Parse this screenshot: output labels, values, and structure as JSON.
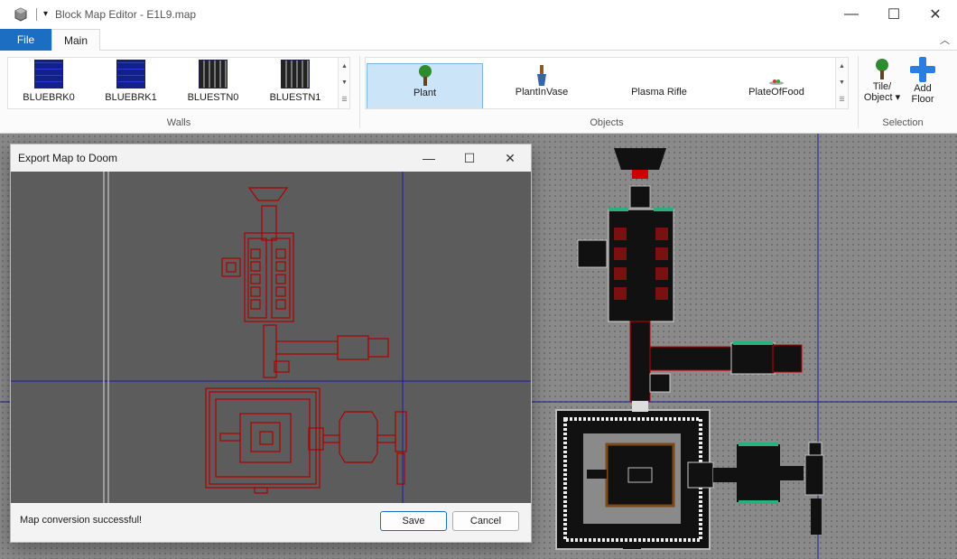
{
  "window": {
    "title": "Block Map Editor - E1L9.map",
    "qat_glyph": "▾",
    "minimize": "—",
    "maximize": "☐",
    "close": "✕"
  },
  "tabs": {
    "file": "File",
    "main": "Main",
    "collapse_glyph": "︿"
  },
  "ribbon": {
    "walls": {
      "label": "Walls",
      "items": [
        {
          "name": "BLUEBRK0",
          "color": "#1a2aa8"
        },
        {
          "name": "BLUEBRK1",
          "color": "#1a2aa8"
        },
        {
          "name": "BLUESTN0",
          "color": "#3a3a3a"
        },
        {
          "name": "BLUESTN1",
          "color": "#3a3a3a"
        }
      ]
    },
    "objects": {
      "label": "Objects",
      "items": [
        {
          "name": "Plant",
          "selected": true
        },
        {
          "name": "PlantInVase",
          "selected": false
        },
        {
          "name": "Plasma Rifle",
          "selected": false
        },
        {
          "name": "PlateOfFood",
          "selected": false
        }
      ]
    },
    "selection": {
      "label": "Selection",
      "tile_object": "Tile/\nObject",
      "tile_object_line1": "Tile/",
      "tile_object_line2": "Object ▾",
      "add_floor_line1": "Add",
      "add_floor_line2": "Floor"
    }
  },
  "dialog": {
    "title": "Export Map to Doom",
    "minimize": "—",
    "maximize": "☐",
    "close": "✕",
    "status": "Map conversion successful!",
    "save": "Save",
    "cancel": "Cancel"
  },
  "colors": {
    "accent": "#1b6ec2",
    "map_red": "#b00000",
    "grid_line": "#1a1aa0"
  }
}
